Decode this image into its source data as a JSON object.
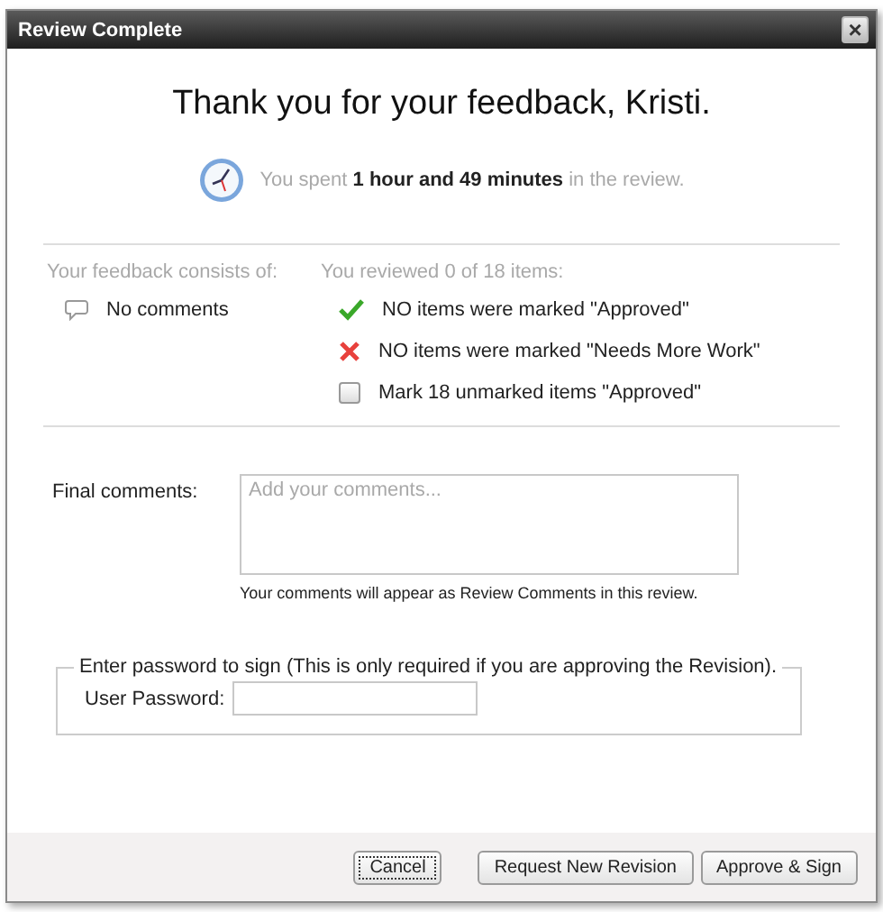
{
  "window": {
    "title": "Review Complete",
    "close": "×"
  },
  "heading": "Thank you for your feedback, Kristi.",
  "time_note": "You spent **1 hour and 49 minutes** in the review.",
  "feedback": {
    "label": "Your feedback consists of:",
    "items": [
      {
        "text": "No comments"
      }
    ]
  },
  "reviewed": {
    "label": "You reviewed 0 of 18 items:",
    "items": [
      {
        "kind": "approved",
        "text": "NO items were marked \"Approved\""
      },
      {
        "kind": "rejected",
        "text": "NO items were marked \"Needs More Work\""
      },
      {
        "kind": "checkbox",
        "text": "Mark 18 unmarked items \"Approved\"",
        "checked": false
      }
    ]
  },
  "final_comments": {
    "label": "Final comments:",
    "placeholder": "Add your comments...",
    "note": "Your comments will appear as Review Comments in this review."
  },
  "signature": {
    "legend": "Enter password to sign (This is only required if you are approving the Revision).",
    "label": "User Password:"
  },
  "buttons": [
    {
      "label": "Cancel",
      "focused": true
    },
    {
      "label": "Request New Revision",
      "focused": false
    },
    {
      "label": "Approve & Sign",
      "focused": false
    }
  ]
}
